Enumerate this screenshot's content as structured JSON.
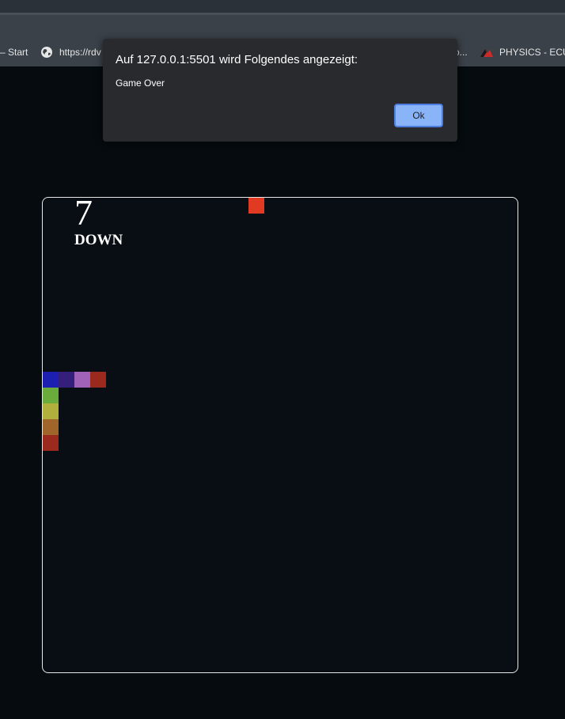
{
  "browser": {
    "bookmarks": {
      "start_label": "– Start",
      "url_label": "https://rdv",
      "ellipsis_label": "o...",
      "physics_label": "PHYSICS - ECU I"
    }
  },
  "dialog": {
    "title": "Auf 127.0.0.1:5501 wird Folgendes angezeigt:",
    "message": "Game Over",
    "ok_label": "Ok"
  },
  "game": {
    "score": "7",
    "direction": "DOWN",
    "grid_size": 30,
    "food": {
      "col": 13,
      "row": 0,
      "color": "#e03a22"
    },
    "snake": [
      {
        "col": 0,
        "row": 11,
        "color": "#1d1fb0"
      },
      {
        "col": 1,
        "row": 11,
        "color": "#34207a"
      },
      {
        "col": 2,
        "row": 11,
        "color": "#a062b8"
      },
      {
        "col": 3,
        "row": 11,
        "color": "#9b2a1e"
      },
      {
        "col": 0,
        "row": 12,
        "color": "#6aab3c"
      },
      {
        "col": 0,
        "row": 13,
        "color": "#b2b03c"
      },
      {
        "col": 0,
        "row": 14,
        "color": "#a0652a"
      },
      {
        "col": 0,
        "row": 15,
        "color": "#9b2a1e"
      }
    ]
  }
}
